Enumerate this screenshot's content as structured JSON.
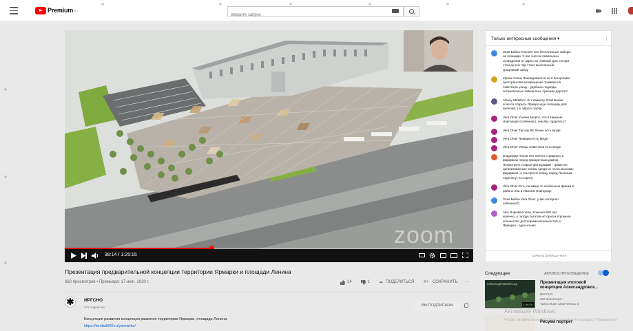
{
  "masthead": {
    "logo_text": "Premium",
    "logo_sup": "RU",
    "search_placeholder": "Введите запрос"
  },
  "player": {
    "timecode": "38:14 / 1:25:15",
    "watermark": "zoom",
    "progress_fraction": 0.36
  },
  "video": {
    "title": "Презентация предварительной концепции территории Ярмарки и площади Ленина",
    "meta": "660 просмотров • Премьера: 17 июн. 2020 г.",
    "likes": "14",
    "dislikes": "1",
    "share_label": "ПОДЕЛИТЬСЯ",
    "save_label": "СОХРАНИТЬ",
    "more": "···"
  },
  "channel": {
    "avatar_glyph": "✱",
    "name": "ИРГСНО",
    "subs": "471 подписчик",
    "subscribe_label": "ВЫ ПОДПИСАНЫ",
    "description": "Концепция развития концепции развития территории Ярмарки, площади Ленина.",
    "link": "https://torebal600.ru/yarmarka/"
  },
  "chat": {
    "title": "Только интересные сообщения ▾",
    "messages": [
      {
        "color": "#3d8be0",
        "lines": [
          "Злая Бабка  Сносите все бесполезные заборы",
          "на площади. У нас снесли павильоны,",
          "ограждения от акрон на главный дом, но при",
          "этом до сих пор стоит высоченный",
          "уродливый забор"
        ]
      },
      {
        "color": "#d1a31c",
        "lines": [
          "Мужик Хасин  Закладывается ли в Концепцию",
          "пространства возвращение трамвая на",
          "советскую улицу - удобные подходы,",
          "остановочные павильоны, сужение дороги?"
        ]
      },
      {
        "color": "#5a5a8a",
        "lines": [
          "Alexey Matafoni  +1 к коменту Злой Бабки,",
          "хочется открыть Ярмарочную площадь для",
          "жителей, т.е. убрать забор"
        ]
      },
      {
        "color": "#a8237a",
        "lines": [
          "Vera Olver  У меня вопрос, что в Нижнем",
          "Новгороде особенного, чем Вы гордитесь?"
        ]
      },
      {
        "color": "#a8237a",
        "lines": [
          "Vera Olver  Так как ВК Ленин есть везде"
        ]
      },
      {
        "color": "#a8237a",
        "lines": [
          "Vera Olver  Ярмарки есть везде"
        ]
      },
      {
        "color": "#a8237a",
        "lines": [
          "Vera Olver  Улицы Советская есть везде"
        ]
      },
      {
        "color": "#e05a2a",
        "lines": [
          "Владимир Попов  Нет ничего страшного в",
          "фарфиках перед ярмарочным домом.",
          "Посмотрите старые фотографии - грамотно",
          "организованные холмы среди не очень высоких",
          "фарфиков. А так просто плацу перед Лениным",
          "перенесут в сторону"
        ]
      },
      {
        "color": "#a8237a",
        "lines": [
          "Vera Olver  Есть ли какие-то особенные фишки в",
          "районе или в Нижнем Новгороде"
        ]
      },
      {
        "color": "#3d8be0",
        "lines": [
          "Злая Бабка  Vera Olver, у вас интернет",
          "забанили?)"
        ]
      },
      {
        "color": "#b05ec9",
        "lines": [
          "Alex Bolyakina  Vera, Конечно 800 лет,",
          "конечно, у города богатая история и огромное",
          "количество достопримечательностей, и",
          "Ярмарка - одна из них."
        ]
      }
    ],
    "footer": "СКРЫТЬ ЗАПИСЬ ЧАТА"
  },
  "related": {
    "header": "Следующее",
    "autoplay_label": "АВТОВОСПРОИЗВЕДЕНИЕ",
    "autoplay_on": true,
    "items": [
      {
        "thumb_caption": "АЛЕКСАНДРОВСКИЙ САД",
        "duration": "1:14:10",
        "title_line1": "Презентация итоговой",
        "title_line2": "концепции Александровск...",
        "channel": "ИРГСНО",
        "views": "262 просмотра •",
        "status": "Трансляция закончилась 3"
      },
      {
        "title_line1": "Рисуем портрет",
        "channel": ""
      }
    ],
    "activate_line1": "Активация Windows",
    "activate_line2": "Чтобы активировать Windows, перейдите в раздел \"Параметры\"."
  },
  "colors": {
    "accent_red": "#ff0000",
    "link_blue": "#065fd4"
  }
}
